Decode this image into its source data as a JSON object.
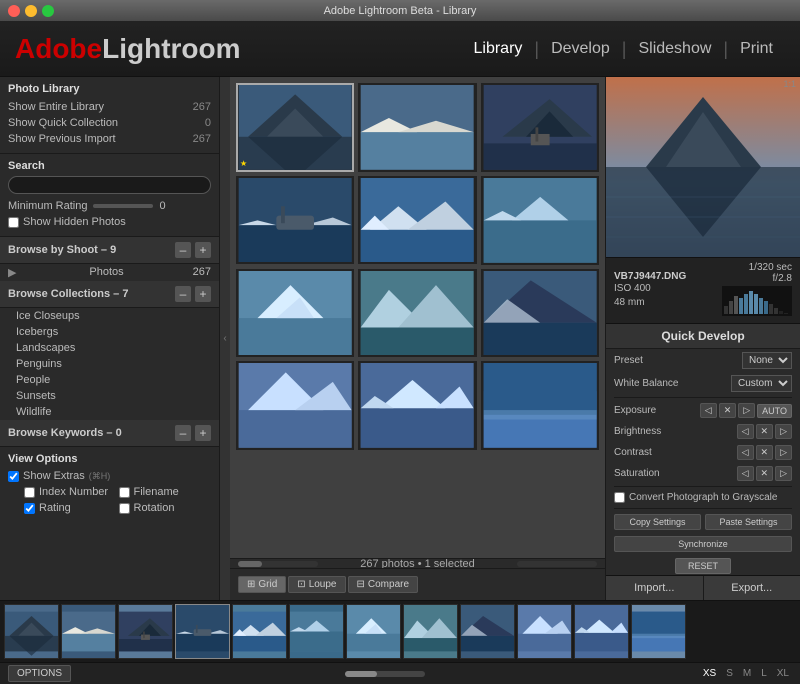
{
  "titlebar": {
    "title": "Adobe Lightroom Beta - Library"
  },
  "header": {
    "logo_adobe": "Adobe",
    "logo_lightroom": "Lightroom",
    "nav": {
      "library": "Library",
      "develop": "Develop",
      "slideshow": "Slideshow",
      "print": "Print"
    }
  },
  "left_panel": {
    "photo_library_title": "Photo Library",
    "show_entire_library": "Show Entire Library",
    "show_entire_count": "267",
    "show_quick_collection": "Show Quick Collection",
    "show_quick_count": "0",
    "show_previous_import": "Show Previous Import",
    "show_previous_count": "267",
    "search_label": "Search",
    "search_placeholder": "",
    "minimum_rating_label": "Minimum Rating",
    "minimum_rating_value": "0",
    "show_hidden_photos": "Show Hidden Photos",
    "browse_by_shoot": "Browse by Shoot",
    "browse_by_shoot_count": "9",
    "photos_label": "Photos",
    "photos_count": "267",
    "browse_collections": "Browse Collections",
    "browse_collections_count": "7",
    "collections": [
      "Ice Closeups",
      "Icebergs",
      "Landscapes",
      "Penguins",
      "People",
      "Sunsets",
      "Wildlife"
    ],
    "browse_keywords": "Browse Keywords",
    "browse_keywords_count": "0",
    "view_options_title": "View Options",
    "show_extras_label": "Show Extras",
    "show_extras_shortcut": "(⌘H)",
    "index_number_label": "Index Number",
    "filename_label": "Filename",
    "rating_label": "Rating",
    "rotation_label": "Rotation"
  },
  "center_panel": {
    "photo_count_text": "267 photos • 1 selected",
    "view_grid": "Grid",
    "view_loupe": "Loupe",
    "view_compare": "Compare"
  },
  "right_panel": {
    "preview_ratio": "1:1",
    "filename": "VB7J9447.DNG",
    "iso": "ISO 400",
    "focal_length": "48 mm",
    "shutter": "1/320 sec",
    "aperture": "f/2.8",
    "quick_develop_title": "Quick Develop",
    "preset_label": "Preset",
    "preset_value": "None",
    "white_balance_label": "White Balance",
    "white_balance_value": "Custom",
    "exposure_label": "Exposure",
    "brightness_label": "Brightness",
    "contrast_label": "Contrast",
    "saturation_label": "Saturation",
    "convert_grayscale": "Convert Photograph to Grayscale",
    "copy_settings_label": "Copy Settings",
    "paste_settings_label": "Paste Settings",
    "synchronize_label": "Synchronize",
    "reset_label": "RESET",
    "import_label": "Import...",
    "export_label": "Export..."
  },
  "bottom_bar": {
    "options_label": "OPTIONS",
    "sizes": [
      "XS",
      "S",
      "M",
      "L",
      "XL"
    ],
    "active_size": "XS"
  },
  "photos": [
    {
      "id": 1,
      "color": "#4a6a8a",
      "type": "mountain-reflection"
    },
    {
      "id": 2,
      "color": "#5a7a9a",
      "type": "ice-plain"
    },
    {
      "id": 3,
      "color": "#3a5a7a",
      "type": "ship-mountain"
    },
    {
      "id": 4,
      "color": "#2a4a6a",
      "type": "boat-ice"
    },
    {
      "id": 5,
      "color": "#4a7a9a",
      "type": "ice-blue"
    },
    {
      "id": 6,
      "color": "#3a6a8a",
      "type": "ice-water"
    },
    {
      "id": 7,
      "color": "#5a8aaa",
      "type": "iceberg"
    },
    {
      "id": 8,
      "color": "#4a7a8a",
      "type": "ice-closeup"
    },
    {
      "id": 9,
      "color": "#3a5a7a",
      "type": "glacier"
    },
    {
      "id": 10,
      "color": "#5a7aaa",
      "type": "ice-blue2"
    },
    {
      "id": 11,
      "color": "#4a6a9a",
      "type": "ice-water2"
    },
    {
      "id": 12,
      "color": "#3a6aaa",
      "type": "ice-wall"
    }
  ],
  "filmstrip_photos": [
    {
      "id": 1,
      "color": "#4a6a8a"
    },
    {
      "id": 2,
      "color": "#3a5a7a"
    },
    {
      "id": 3,
      "color": "#5a7a9a"
    },
    {
      "id": 4,
      "color": "#2a4a6a"
    },
    {
      "id": 5,
      "color": "#4a7a9a"
    },
    {
      "id": 6,
      "color": "#3a6a8a"
    },
    {
      "id": 7,
      "color": "#5a8aaa"
    },
    {
      "id": 8,
      "color": "#4a7a8a"
    },
    {
      "id": 9,
      "color": "#3a5a7a"
    },
    {
      "id": 10,
      "color": "#5a7aaa"
    },
    {
      "id": 11,
      "color": "#4a6a9a"
    },
    {
      "id": 12,
      "color": "#6a8aaa"
    }
  ]
}
